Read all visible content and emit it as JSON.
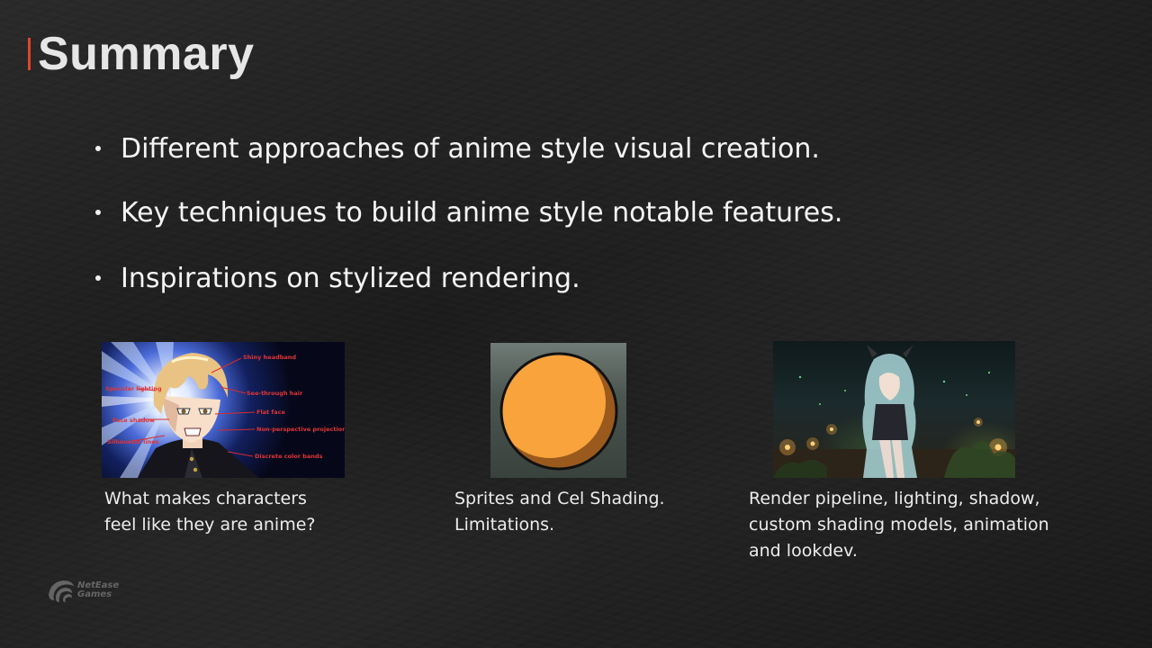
{
  "slide": {
    "title": "Summary",
    "accent_color": "#e0452a"
  },
  "bullets": [
    {
      "text": "Different approaches of anime style visual creation."
    },
    {
      "text": "Key techniques to build anime style notable features."
    },
    {
      "text": "Inspirations on stylized rendering."
    }
  ],
  "cards": [
    {
      "image": {
        "labels": [
          "Shiny headband",
          "Specular lighting",
          "See-through hair",
          "Flat face",
          "Face shadow",
          "Non-perspective projection",
          "Silhouette lines",
          "Discrete color bands"
        ]
      },
      "caption_lines": [
        "What makes characters",
        "feel like they are anime?"
      ]
    },
    {
      "image": {
        "sphere_color": "#f9a33d",
        "shadow_color": "#9a5a1d"
      },
      "caption_lines": [
        "Sprites and Cel Shading.",
        "Limitations."
      ]
    },
    {
      "image": {},
      "caption_lines": [
        "Render pipeline, lighting, shadow,",
        "custom shading models, animation",
        "and lookdev."
      ]
    }
  ],
  "logo": {
    "line1": "NetEase",
    "line2": "Games"
  }
}
